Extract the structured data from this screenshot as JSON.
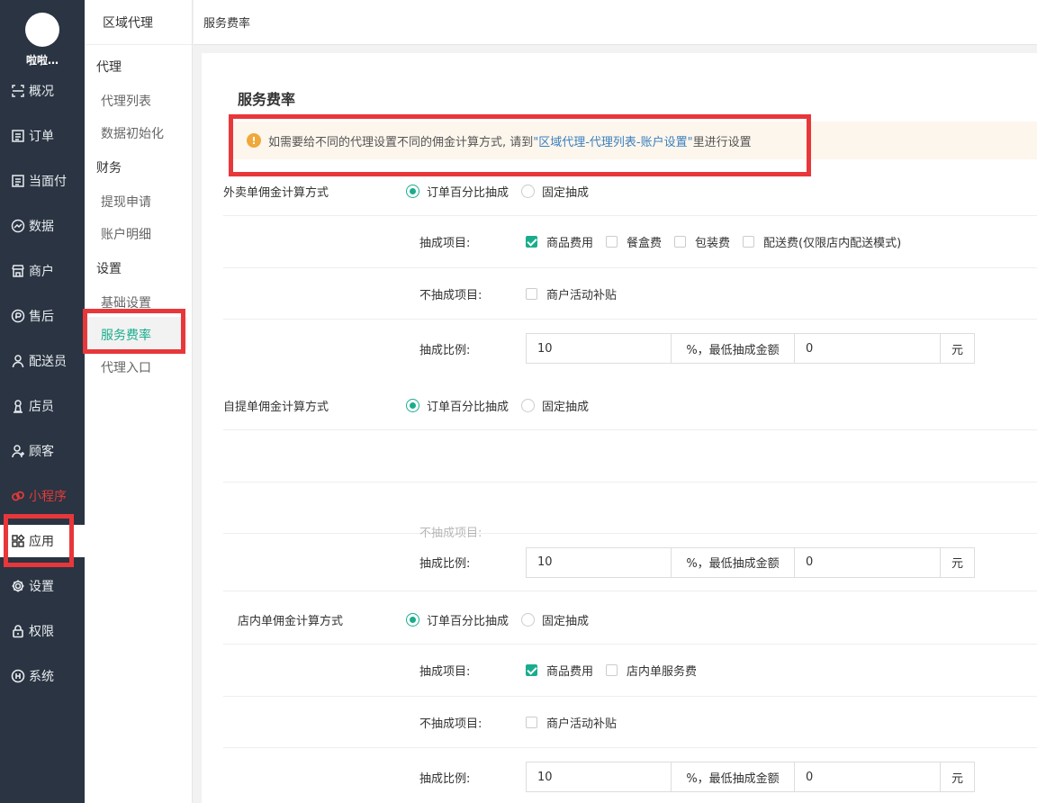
{
  "nav": {
    "username": "啦啦…",
    "items": [
      {
        "label": "概况",
        "icon": "overview-icon"
      },
      {
        "label": "订单",
        "icon": "order-icon"
      },
      {
        "label": "当面付",
        "icon": "pay-icon"
      },
      {
        "label": "数据",
        "icon": "data-icon"
      },
      {
        "label": "商户",
        "icon": "store-icon"
      },
      {
        "label": "售后",
        "icon": "aftersale-icon"
      },
      {
        "label": "配送员",
        "icon": "courier-icon"
      },
      {
        "label": "店员",
        "icon": "clerk-icon"
      },
      {
        "label": "顾客",
        "icon": "customer-icon"
      },
      {
        "label": "小程序",
        "icon": "miniprogram-icon"
      },
      {
        "label": "应用",
        "icon": "apps-icon"
      },
      {
        "label": "设置",
        "icon": "gear-icon"
      },
      {
        "label": "权限",
        "icon": "lock-icon"
      },
      {
        "label": "系统",
        "icon": "system-icon"
      }
    ]
  },
  "sub": {
    "title": "区域代理",
    "groups": [
      "代理",
      "财务",
      "设置"
    ],
    "items": [
      "代理列表",
      "数据初始化",
      "提现申请",
      "账户明细",
      "基础设置",
      "服务费率",
      "代理入口"
    ]
  },
  "topbar": {
    "title": "服务费率"
  },
  "card": {
    "title": "服务费率",
    "notice_prefix": "如需要给不同的代理设置不同的佣金计算方式, 请到",
    "notice_link": "\"区域代理-代理列表-账户设置\"",
    "notice_suffix": "里进行设置"
  },
  "labels": {
    "radio_percent": "订单百分比抽成",
    "radio_fixed": "固定抽成",
    "items_label": "抽成项目:",
    "exclude_label": "不抽成项目:",
    "ratio_label": "抽成比例:",
    "min_label": "%，最低抽成金额",
    "unit": "元",
    "goods_fee": "商品费用",
    "box_fee": "餐盒费",
    "pack_fee": "包装费",
    "delivery_fee": "配送费(仅限店内配送模式)",
    "subsidy": "商户活动补贴",
    "dinein_service": "店内单服务费"
  },
  "sections": {
    "takeout": {
      "label": "外卖单佣金计算方式",
      "ratio": "10",
      "min": "0"
    },
    "pickup": {
      "label": "自提单佣金计算方式",
      "ratio": "10",
      "min": "0"
    },
    "dinein": {
      "label": "店内单佣金计算方式",
      "ratio": "10",
      "min": "0"
    }
  },
  "colors": {
    "accent": "#1aad8d",
    "nav_bg": "#2a3442",
    "highlight": "#e8373a"
  }
}
